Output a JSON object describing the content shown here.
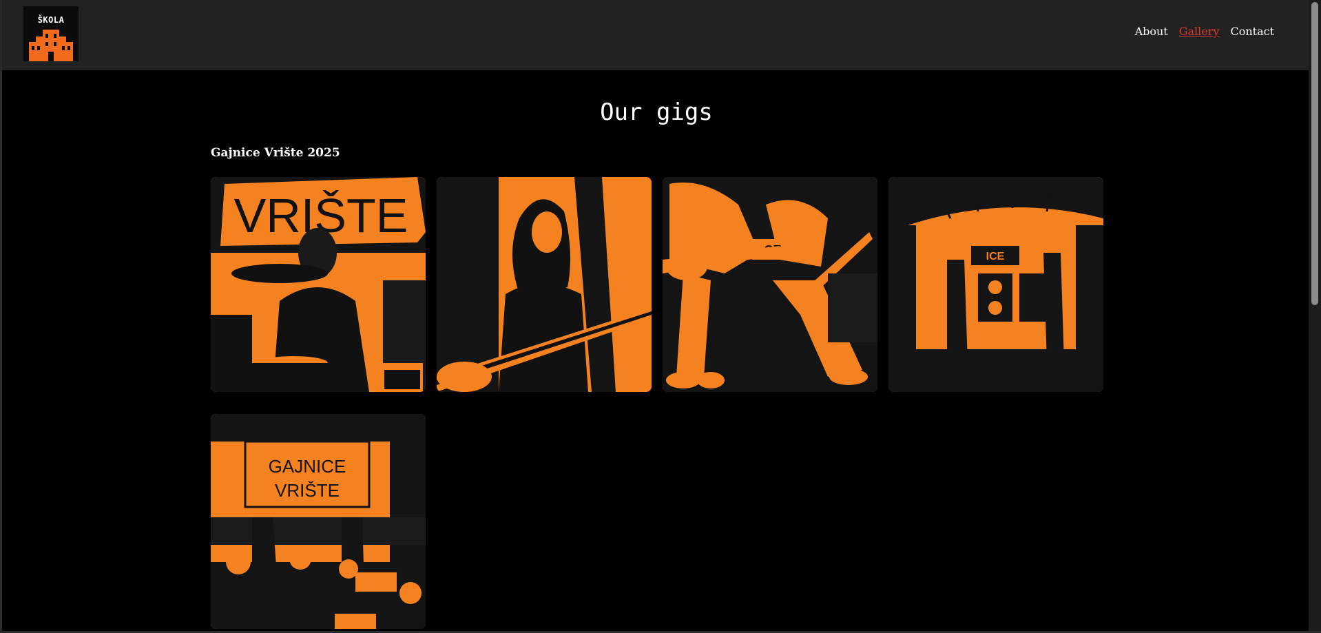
{
  "header": {
    "logo_text": "ŠKOLA",
    "nav": {
      "about": "About",
      "gallery": "Gallery",
      "contact": "Contact"
    }
  },
  "main": {
    "title": "Our gigs",
    "section_title": "Gajnice Vrište 2025",
    "photo_sign_texts": [
      "VRIŠTE",
      "GAJNICE",
      "VRIŠTE",
      "CE",
      "ICE"
    ]
  },
  "colors": {
    "accent_orange": "#f58220",
    "active_link": "#e03a2f",
    "header_bg": "#222222",
    "page_bg": "#000000"
  }
}
